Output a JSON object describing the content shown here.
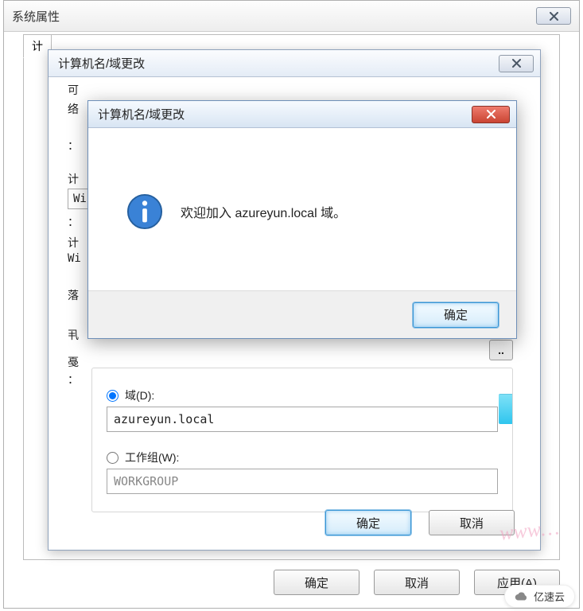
{
  "sysprops": {
    "title": "系统属性",
    "tab_label": "计",
    "buttons": {
      "ok": "确定",
      "cancel": "取消",
      "apply": "应用(A)"
    }
  },
  "dialog": {
    "title": "计算机名/域更改",
    "intro_line1": "可",
    "intro_line2": "络",
    "row1_label": "计",
    "row1_value": "Wi",
    "row2_label": "计",
    "row2_value": "Wi",
    "row_colon": "：",
    "more_button": "..",
    "membership": {
      "legend": "隶",
      "domain_label": "域(D):",
      "domain_value": "azureyun.local",
      "workgroup_label": "工作组(W):",
      "workgroup_value": "WORKGROUP"
    },
    "buttons": {
      "ok": "确定",
      "cancel": "取消"
    }
  },
  "msgbox": {
    "title": "计算机名/域更改",
    "message": "欢迎加入 azureyun.local 域。",
    "ok": "确定"
  },
  "watermark": {
    "script": "www…",
    "pill": "亿速云"
  }
}
